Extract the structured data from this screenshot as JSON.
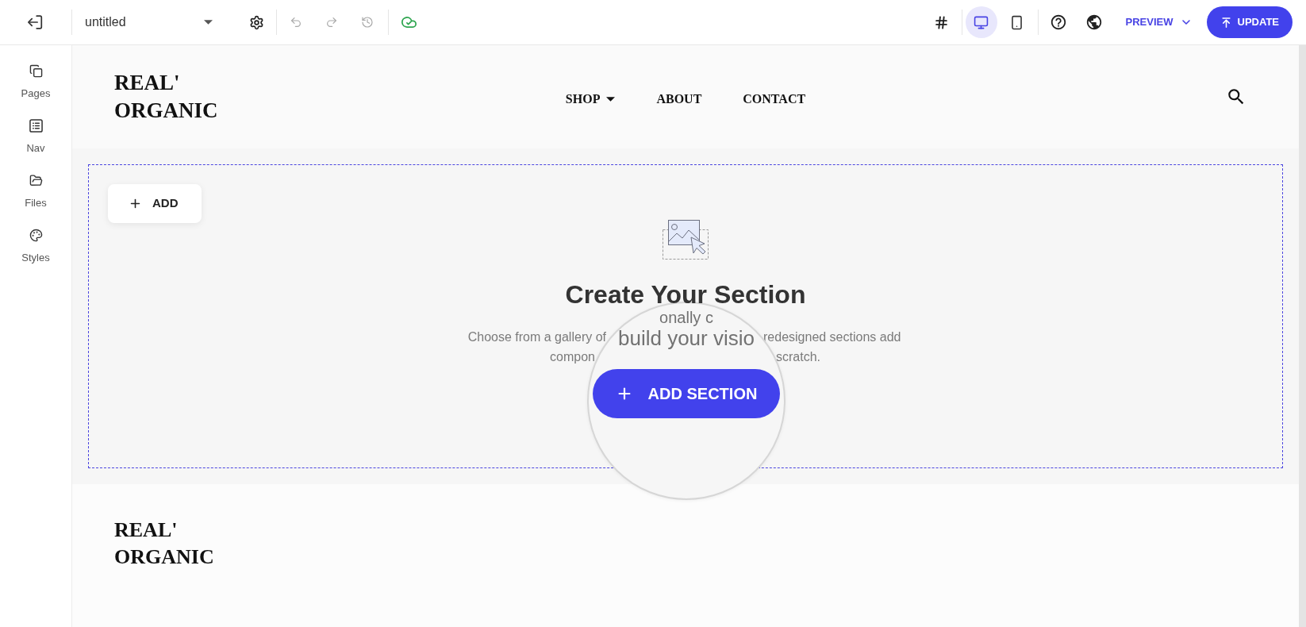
{
  "toolbar": {
    "document_title": "untitled",
    "history": [
      {
        "kind": "undo",
        "disabled": true
      },
      {
        "kind": "redo",
        "disabled": true
      },
      {
        "kind": "restore",
        "disabled": true
      }
    ],
    "devices": [
      {
        "kind": "desktop",
        "selected": true
      },
      {
        "kind": "mobile",
        "selected": false
      }
    ],
    "preview": "PREVIEW",
    "update": "UPDATE"
  },
  "sidebar": {
    "items": [
      {
        "kind": "pages",
        "label": "Pages"
      },
      {
        "kind": "nav",
        "label": "Nav"
      },
      {
        "kind": "files",
        "label": "Files"
      },
      {
        "kind": "styles",
        "label": "Styles"
      }
    ]
  },
  "site_header": {
    "logo": [
      "REAL'",
      "ORGANIC"
    ],
    "nav": [
      {
        "label": "SHOP",
        "dropdown": true
      },
      {
        "label": "ABOUT",
        "dropdown": false
      },
      {
        "label": "CONTACT",
        "dropdown": false
      }
    ]
  },
  "section": {
    "add_button": "ADD",
    "heading": "Create Your Section",
    "description_lines": [
      {
        "left": "Choose from a gallery of",
        "right": "redesigned sections add"
      },
      {
        "left": "compon",
        "right": "scratch."
      }
    ],
    "magnifier": {
      "lines": [
        "onally c",
        "build your visio"
      ],
      "button": "ADD SECTION"
    }
  },
  "footer": {
    "logo": [
      "REAL'",
      "ORGANIC"
    ]
  }
}
